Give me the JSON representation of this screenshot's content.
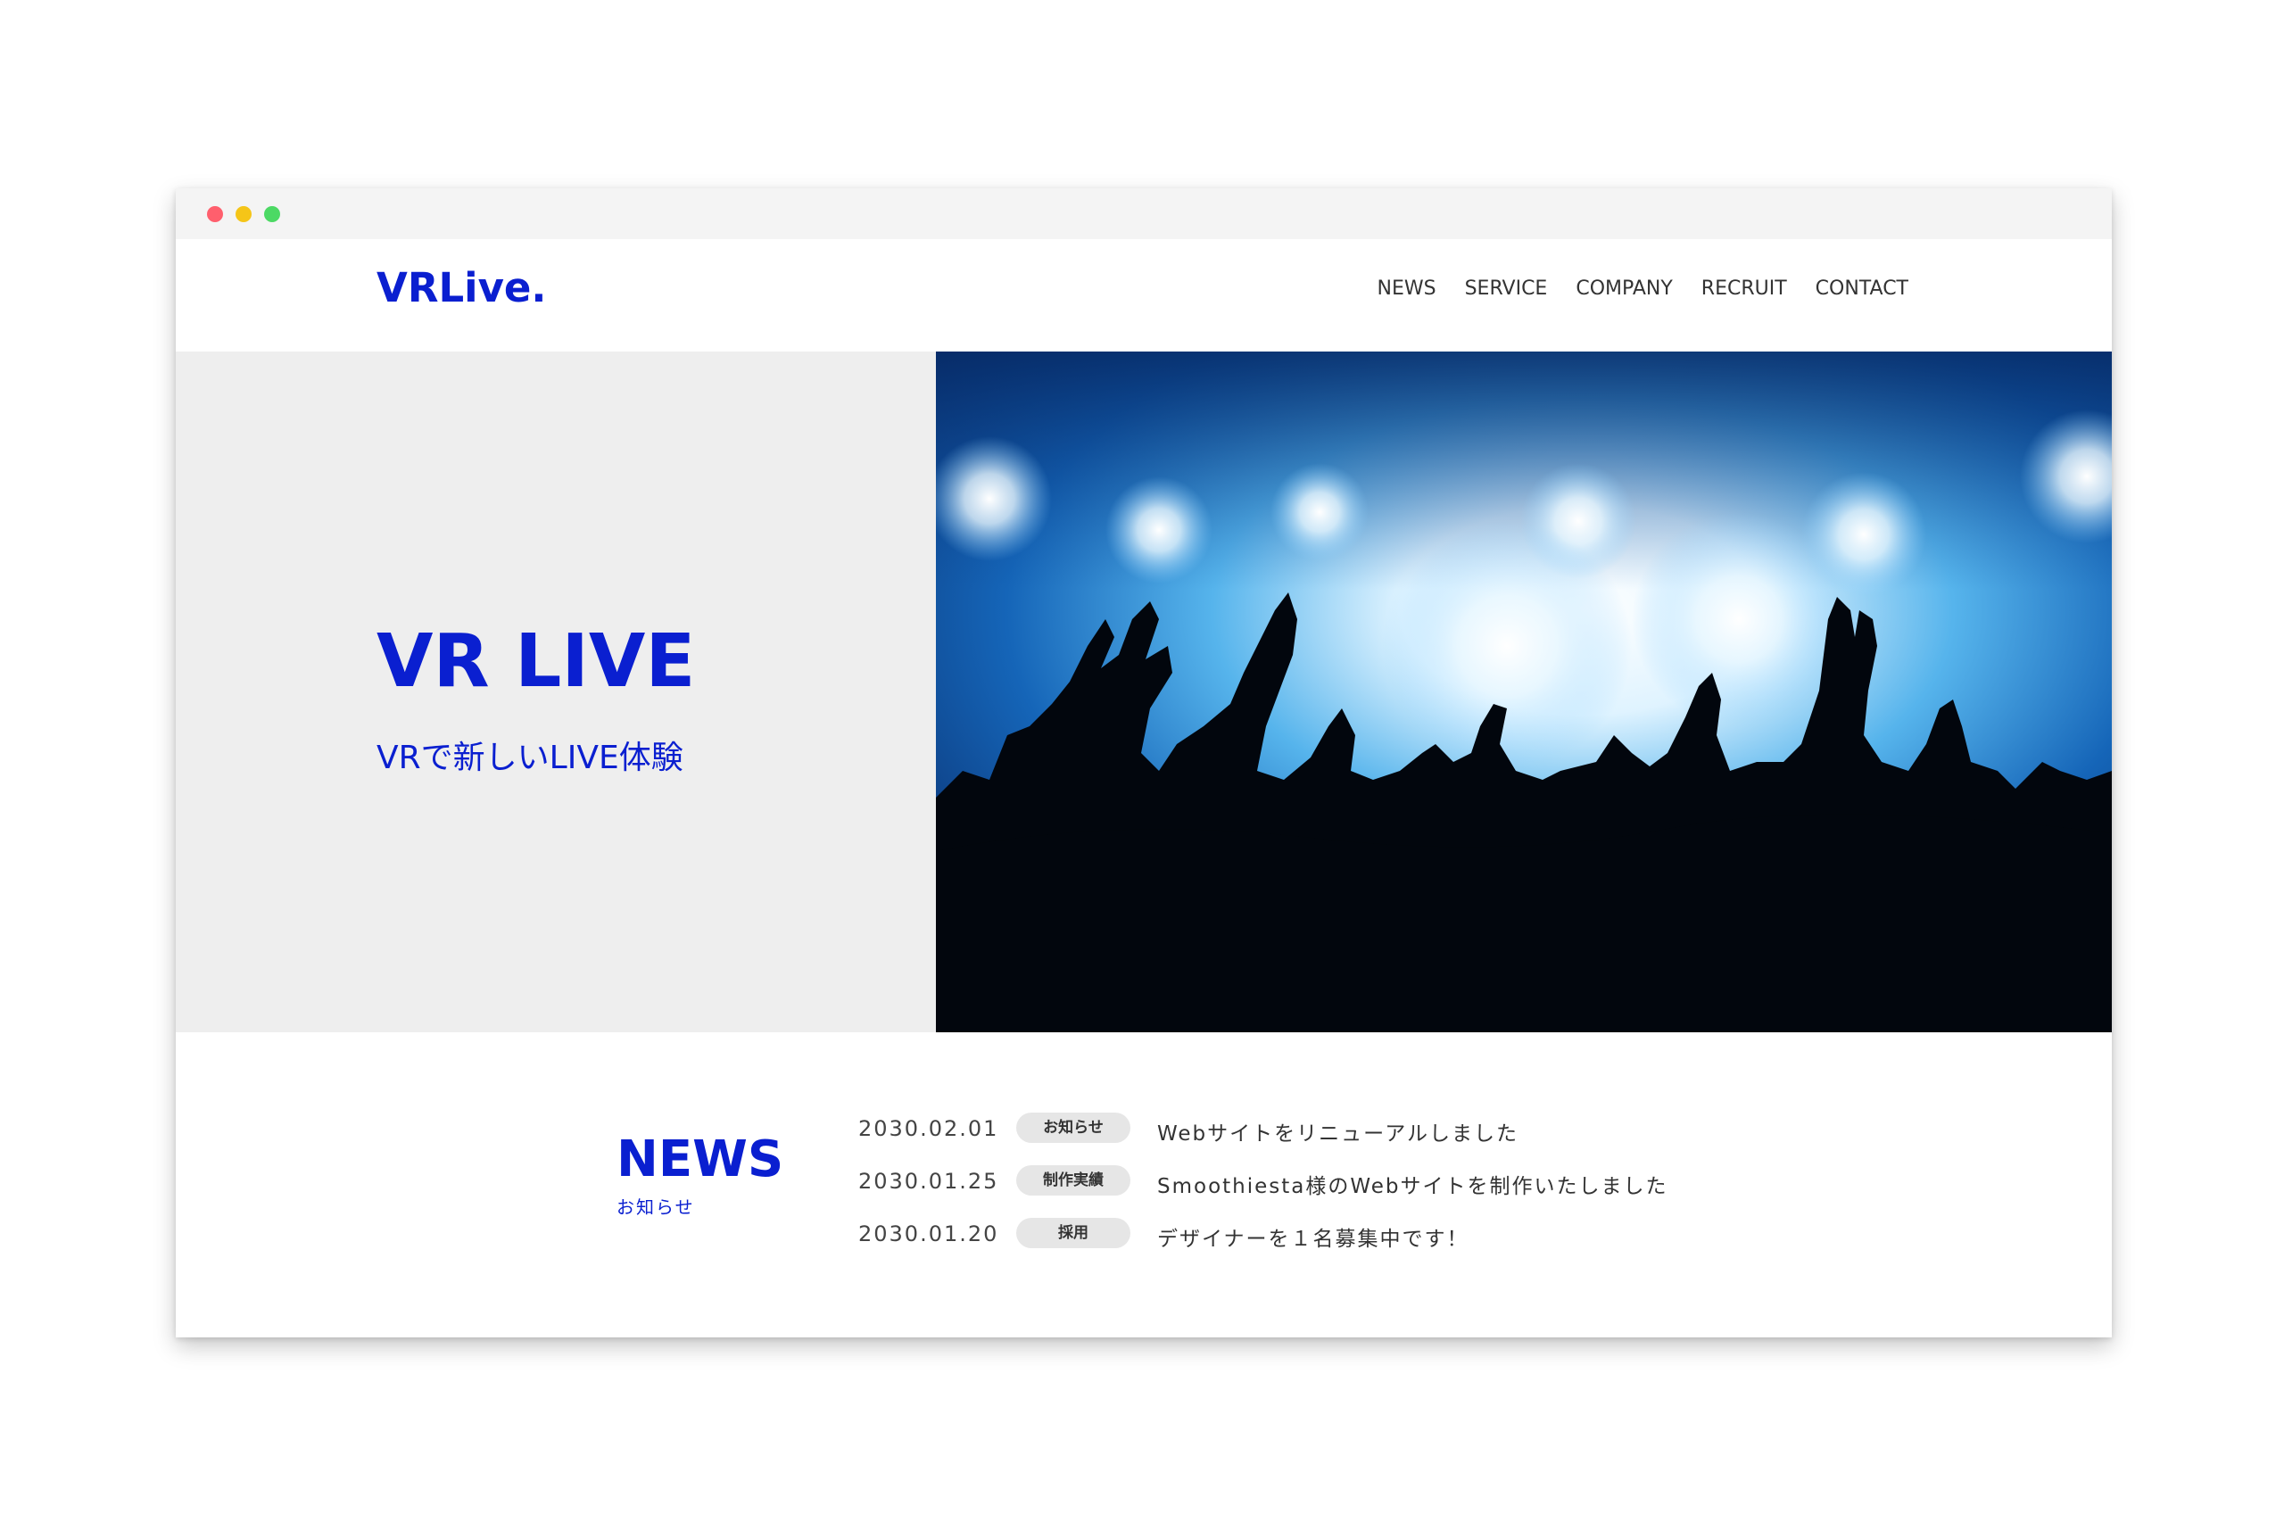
{
  "window": {
    "controls": [
      "close",
      "minimize",
      "maximize"
    ]
  },
  "header": {
    "logo": "VRLive.",
    "nav": [
      "NEWS",
      "SERVICE",
      "COMPANY",
      "RECRUIT",
      "CONTACT"
    ]
  },
  "hero": {
    "title": "VR LIVE",
    "subtitle": "VRで新しいLIVE体験"
  },
  "news": {
    "heading": "NEWS",
    "subheading": "お知らせ",
    "items": [
      {
        "date": "2030.02.01",
        "tag": "お知らせ",
        "title": "Webサイトをリニューアルしました"
      },
      {
        "date": "2030.01.25",
        "tag": "制作実績",
        "title": "Smoothiesta様のWebサイトを制作いたしました"
      },
      {
        "date": "2030.01.20",
        "tag": "採用",
        "title": "デザイナーを１名募集中です！"
      }
    ]
  },
  "colors": {
    "brand": "#0a1fd0",
    "hero_panel": "#eeeeee",
    "tag_bg": "#e6e6e6",
    "text": "#333333"
  }
}
